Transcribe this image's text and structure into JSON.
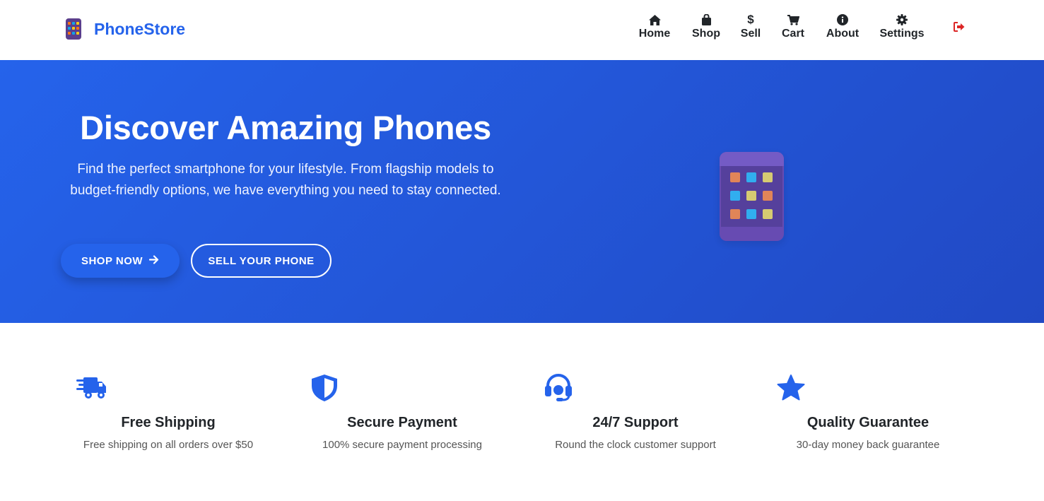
{
  "brand": {
    "name": "PhoneStore"
  },
  "nav": {
    "items": [
      {
        "label": "Home",
        "icon": "home-icon"
      },
      {
        "label": "Shop",
        "icon": "shopping-bag-icon"
      },
      {
        "label": "Sell",
        "icon": "dollar-icon"
      },
      {
        "label": "Cart",
        "icon": "cart-icon"
      },
      {
        "label": "About",
        "icon": "info-icon"
      },
      {
        "label": "Settings",
        "icon": "gear-icon"
      }
    ],
    "logout_icon": "logout-icon"
  },
  "hero": {
    "title": "Discover Amazing Phones",
    "subtitle": "Find the perfect smartphone for your lifestyle. From flagship models to budget-friendly options, we have everything you need to stay connected.",
    "primary_button": "SHOP NOW",
    "secondary_button": "SELL YOUR PHONE"
  },
  "features": [
    {
      "icon": "shipping-truck-icon",
      "title": "Free Shipping",
      "description": "Free shipping on all orders over $50"
    },
    {
      "icon": "shield-icon",
      "title": "Secure Payment",
      "description": "100% secure payment processing"
    },
    {
      "icon": "headset-icon",
      "title": "24/7 Support",
      "description": "Round the clock customer support"
    },
    {
      "icon": "star-icon",
      "title": "Quality Guarantee",
      "description": "30-day money back guarantee"
    }
  ],
  "colors": {
    "accent": "#2563eb",
    "hero_start": "#2563eb",
    "hero_end": "#2149c4",
    "logout": "#dc2626",
    "text": "#212529"
  }
}
